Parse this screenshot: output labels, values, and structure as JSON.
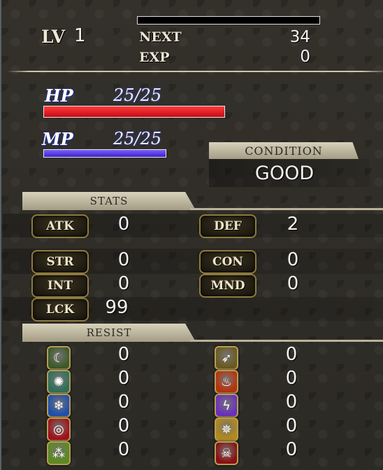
{
  "level": {
    "label": "LV",
    "value": "1"
  },
  "next": {
    "label": "NEXT",
    "value": "34"
  },
  "exp": {
    "label": "EXP",
    "value": "0",
    "progress": 0
  },
  "hp": {
    "label": "HP",
    "value": "25/25",
    "fraction": 1.0,
    "color": "#e0121e"
  },
  "mp": {
    "label": "MP",
    "value": "25/25",
    "fraction": 1.0,
    "color": "#5d3df0"
  },
  "condition": {
    "label": "CONDITION",
    "value": "GOOD"
  },
  "stats": {
    "header": "STATS",
    "atk": {
      "label": "ATK",
      "value": "0"
    },
    "def": {
      "label": "DEF",
      "value": "2"
    },
    "str": {
      "label": "STR",
      "value": "0"
    },
    "con": {
      "label": "CON",
      "value": "0"
    },
    "int": {
      "label": "INT",
      "value": "0"
    },
    "mnd": {
      "label": "MND",
      "value": "0"
    },
    "lck": {
      "label": "LCK",
      "value": "99"
    }
  },
  "resist": {
    "header": "RESIST",
    "left": [
      {
        "icon": "moon-icon",
        "glyph": "☾",
        "bg": "#3c5a2a",
        "value": "0"
      },
      {
        "icon": "wind-burst-icon",
        "glyph": "✺",
        "bg": "#2f6f5a",
        "value": "0"
      },
      {
        "icon": "ice-crystal-icon",
        "glyph": "❄",
        "bg": "#1d4fb0",
        "value": "0"
      },
      {
        "icon": "vortex-icon",
        "glyph": "◎",
        "bg": "#a0101a",
        "value": "0"
      },
      {
        "icon": "poison-icon",
        "glyph": "⁂",
        "bg": "#5c8a1e",
        "value": "0"
      }
    ],
    "right": [
      {
        "icon": "arrow-burst-icon",
        "glyph": "➶",
        "bg": "#6a5a22",
        "value": "0"
      },
      {
        "icon": "fire-icon",
        "glyph": "♨",
        "bg": "#b8310c",
        "value": "0"
      },
      {
        "icon": "lightning-icon",
        "glyph": "ϟ",
        "bg": "#6a2fc0",
        "value": "0"
      },
      {
        "icon": "holy-sigil-icon",
        "glyph": "✵",
        "bg": "#b38a1a",
        "value": "0"
      },
      {
        "icon": "skull-curse-icon",
        "glyph": "☠",
        "bg": "#8a0f12",
        "value": "0"
      }
    ]
  }
}
